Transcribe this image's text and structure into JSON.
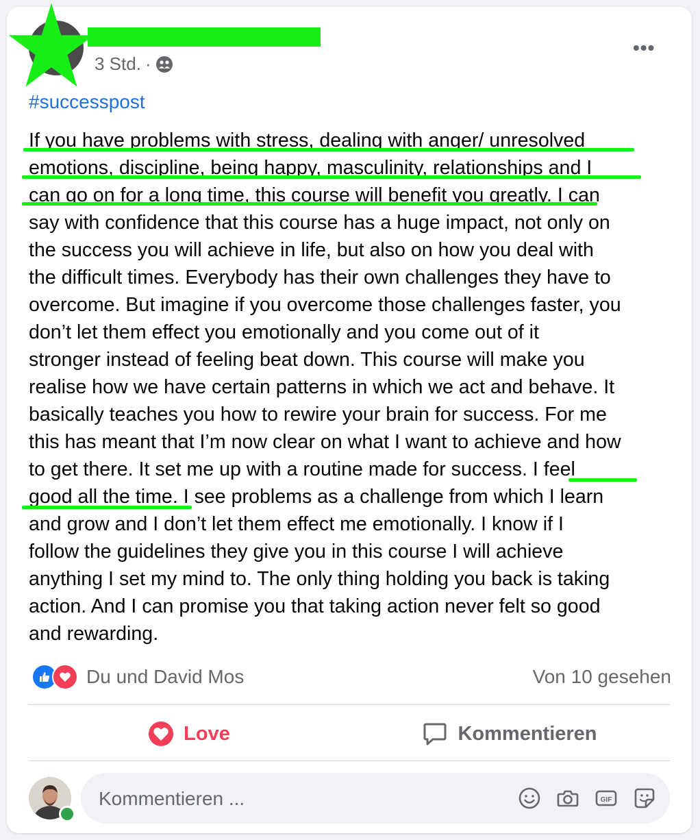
{
  "post": {
    "time": "3 Std.",
    "separator": "·",
    "hashtag": "#successpost",
    "body_lines": [
      "If you have problems with stress, dealing with anger/ unresolved",
      "emotions, discipline, being happy, masculinity, relationships and I",
      "can go on for a long time, this course will benefit you greatly. I can",
      "say with confidence that this course has a huge impact, not only on",
      "the success you will achieve in life, but also on how you deal with",
      "the difficult times. Everybody has their own challenges they have to",
      "overcome. But imagine if you overcome those challenges faster, you",
      "don’t let them effect you emotionally and you come out of it",
      "stronger instead of feeling beat down. This course will make you",
      "realise how we have certain patterns in which we act and behave. It",
      "basically teaches you how to rewire your brain for success. For me",
      "this has meant that I’m now clear on what I want to achieve and how",
      "to get there. It set me up with a routine made for success. I feel",
      "good all the time. I see problems as a challenge from which I learn",
      "and grow and I don’t let them effect me emotionally. I know if I",
      "follow the guidelines they give you in this course I will achieve",
      "anything I set my mind to. The only thing holding you back is taking",
      "action. And I can promise you that taking action never felt so good",
      "and rewarding."
    ]
  },
  "reactions": {
    "names": "Du und David Mos",
    "seen": "Von 10 gesehen"
  },
  "actions": {
    "love_label": "Love",
    "comment_label": "Kommentieren"
  },
  "comment_input": {
    "placeholder": "Kommentieren ..."
  },
  "icons": {
    "privacy": "group-icon",
    "more": "more-options-icon",
    "like": "like-reaction-icon",
    "love": "love-reaction-icon",
    "comment": "comment-icon",
    "emoji": "emoji-icon",
    "camera": "camera-icon",
    "gif": "gif-icon",
    "sticker": "sticker-icon"
  },
  "colors": {
    "highlight": "#17ee17",
    "link": "#216fdb",
    "love": "#f33e58",
    "like": "#1877f2",
    "online": "#31a24c"
  }
}
